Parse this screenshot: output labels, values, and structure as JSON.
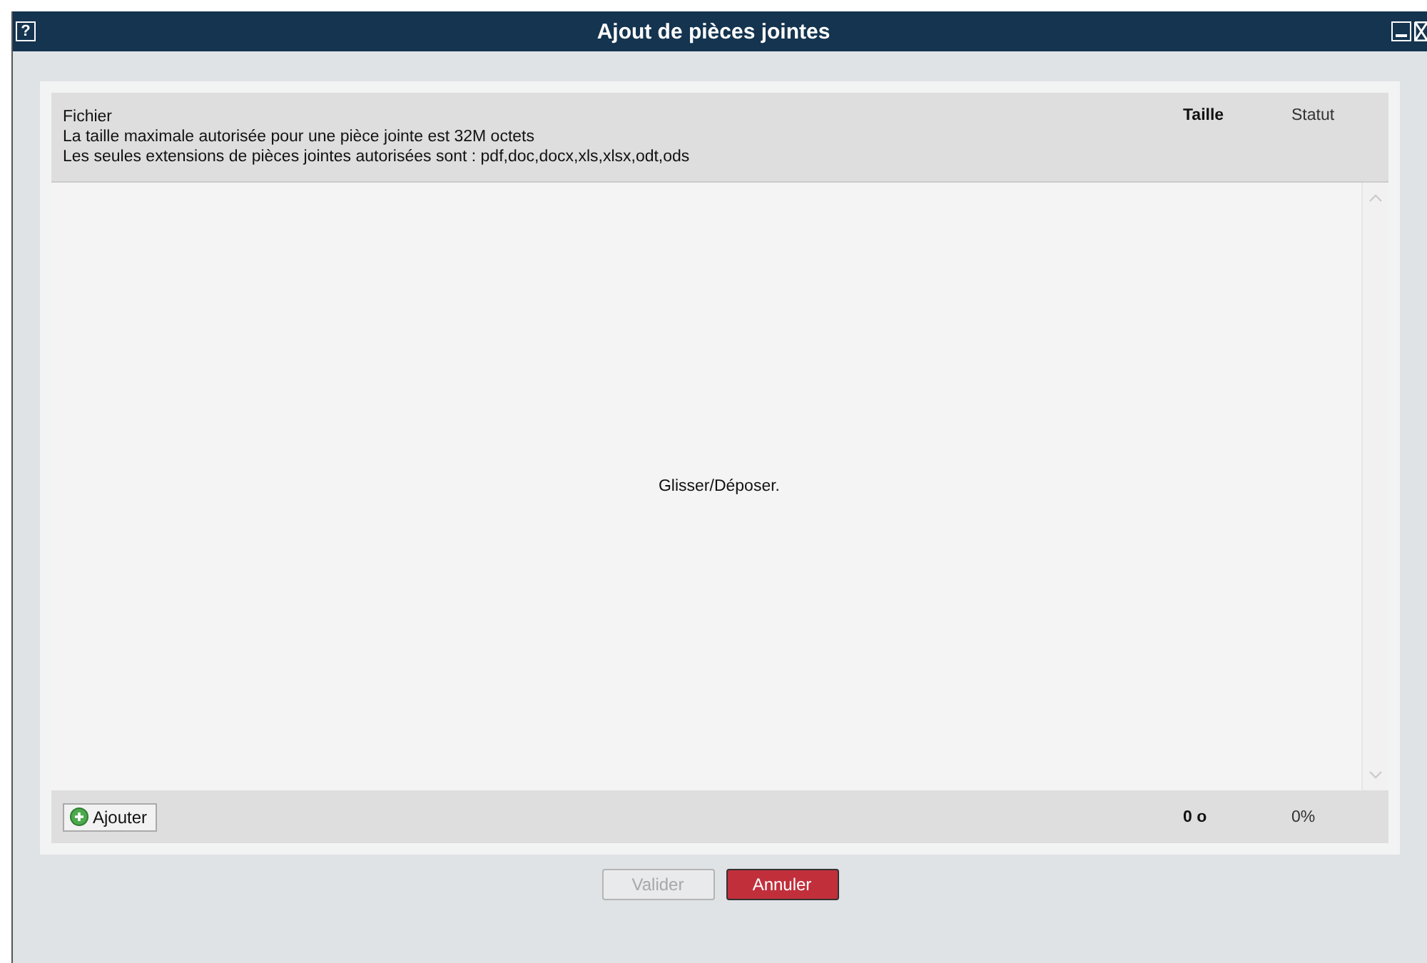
{
  "window": {
    "title": "Ajout de pièces jointes",
    "help": "?"
  },
  "table": {
    "columns": [
      {
        "label": "Fichier",
        "bold": false
      },
      {
        "label": "Taille",
        "bold": true
      },
      {
        "label": "Statut",
        "bold": false
      }
    ],
    "notes": [
      "La taille maximale autorisée pour une pièce jointe est 32M octets",
      "Les seules extensions de pièces jointes autorisées sont : pdf,doc,docx,xls,xlsx,odt,ods"
    ],
    "drop_hint": "Glisser/Déposer.",
    "footer": {
      "add_button": "Ajouter",
      "total_size": "0 o",
      "total_status": "0%"
    }
  },
  "buttons": [
    {
      "label": "Valider",
      "kind": "secondary",
      "disabled": true
    },
    {
      "label": "Annuler",
      "kind": "primary",
      "disabled": false
    }
  ]
}
